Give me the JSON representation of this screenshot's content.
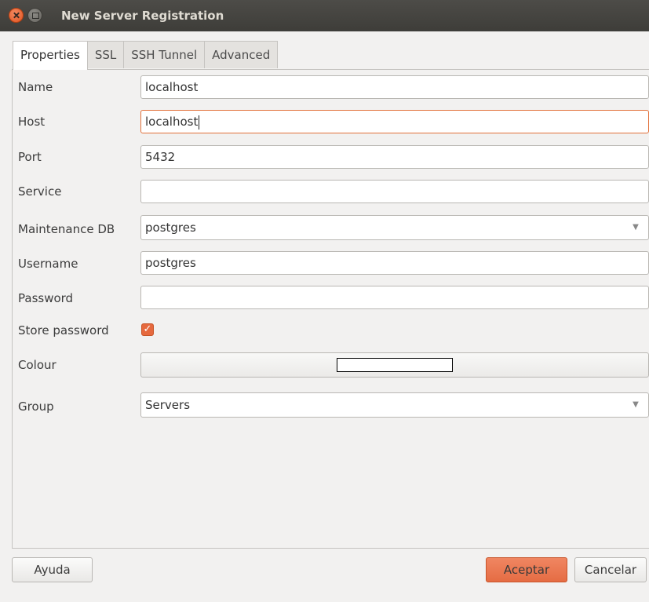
{
  "window": {
    "title": "New Server Registration"
  },
  "tabs": [
    {
      "label": "Properties",
      "active": true
    },
    {
      "label": "SSL",
      "active": false
    },
    {
      "label": "SSH Tunnel",
      "active": false
    },
    {
      "label": "Advanced",
      "active": false
    }
  ],
  "form": {
    "name": {
      "label": "Name",
      "value": "localhost"
    },
    "host": {
      "label": "Host",
      "value": "localhost"
    },
    "port": {
      "label": "Port",
      "value": "5432"
    },
    "service": {
      "label": "Service",
      "value": ""
    },
    "maintenance_db": {
      "label": "Maintenance DB",
      "value": "postgres"
    },
    "username": {
      "label": "Username",
      "value": "postgres"
    },
    "password": {
      "label": "Password",
      "value": ""
    },
    "store_password": {
      "label": "Store password",
      "checked": true
    },
    "colour": {
      "label": "Colour",
      "swatch_color": "#ffffff"
    },
    "group": {
      "label": "Group",
      "value": "Servers"
    }
  },
  "buttons": {
    "help": "Ayuda",
    "ok": "Aceptar",
    "cancel": "Cancelar"
  },
  "icons": {
    "close": "close-icon",
    "minimize": "minimize-icon",
    "check": "checkmark-icon",
    "dropdown": "chevron-down-icon"
  },
  "colors": {
    "accent": "#e56c43",
    "titlebar": "#3e3d39",
    "focus_border": "#e2703a"
  }
}
